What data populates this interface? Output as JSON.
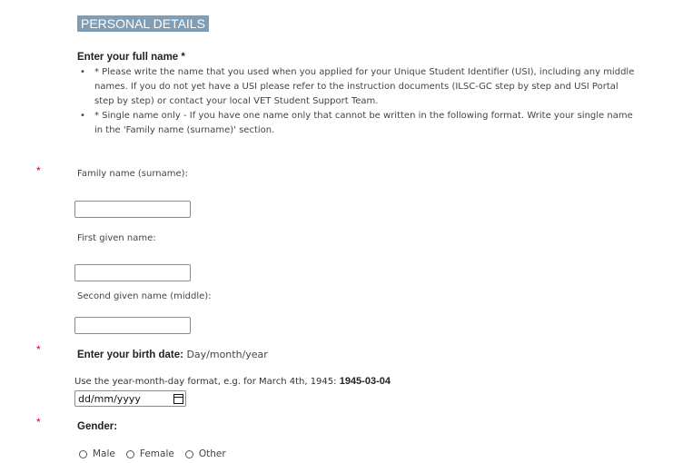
{
  "section": {
    "title": "PERSONAL DETAILS"
  },
  "full_name": {
    "label": "Enter your full name *",
    "instructions": [
      "* Please write the name that you used when you applied for your Unique Student Identifier (USI), including any middle names. If you do not yet have a USI please refer to the instruction documents (ILSC-GC step by step and USI Portal step by step) or contact your local VET Student Support Team.",
      "* Single name only - If you have one name only that cannot be written in the following format. Write your single name in the 'Family name (surname)' section."
    ],
    "required_marker": "*",
    "family_name": {
      "label": "Family name (surname):",
      "value": ""
    },
    "first_given_name": {
      "label": "First given name:",
      "value": ""
    },
    "second_given_name": {
      "label": "Second given name (middle):",
      "value": ""
    }
  },
  "birth_date": {
    "label": "Enter your birth date:",
    "format_hint": "Day/month/year",
    "required_marker": "*",
    "instruction_text": "Use the year-month-day format, e.g. for March 4th, 1945:",
    "example": "1945-03-04",
    "placeholder": "dd/mm/yyyy",
    "icon": "calendar-icon"
  },
  "gender": {
    "label": "Gender:",
    "required_marker": "*",
    "options": [
      "Male",
      "Female",
      "Other"
    ]
  },
  "colors": {
    "section_header_bg": "#7f9db5",
    "required": "#d0021b"
  }
}
